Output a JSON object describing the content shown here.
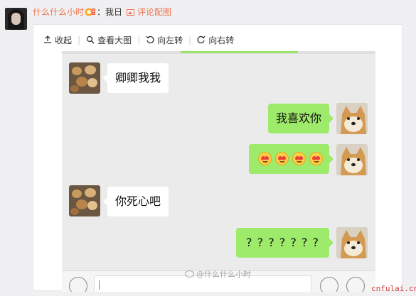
{
  "post": {
    "username": "什么什么小时",
    "colon": "：",
    "text": "我日",
    "comment_image_label": "评论配图"
  },
  "toolbar": {
    "collapse_label": "收起",
    "view_large_label": "查看大图",
    "rotate_left_label": "向左转",
    "rotate_right_label": "向右转"
  },
  "chat": {
    "messages": [
      {
        "side": "left",
        "text": "卿卿我我",
        "avatar": "cats-avatar"
      },
      {
        "side": "right",
        "text": "我喜欢你",
        "avatar": "doge-avatar"
      },
      {
        "side": "right",
        "text": "",
        "emoji_count": 4,
        "emoji": "heart-eyes-emoji",
        "avatar": "doge-avatar"
      },
      {
        "side": "left",
        "text": "你死心吧",
        "avatar": "cats-avatar"
      },
      {
        "side": "right",
        "text": "? ? ? ? ? ? ?",
        "avatar": "doge-avatar"
      }
    ]
  },
  "watermark": "@什么什么小时",
  "site_mark": "cnfulai.cn",
  "colors": {
    "accent": "#eb7350",
    "bubble_green": "#9eea6a",
    "bubble_white": "#ffffff",
    "chat_bg": "#ebebeb"
  },
  "icons": [
    "upload-icon",
    "search-icon",
    "rotate-left-icon",
    "rotate-right-icon",
    "picture-icon",
    "vip-badge-icon",
    "weibo-logo-icon"
  ]
}
